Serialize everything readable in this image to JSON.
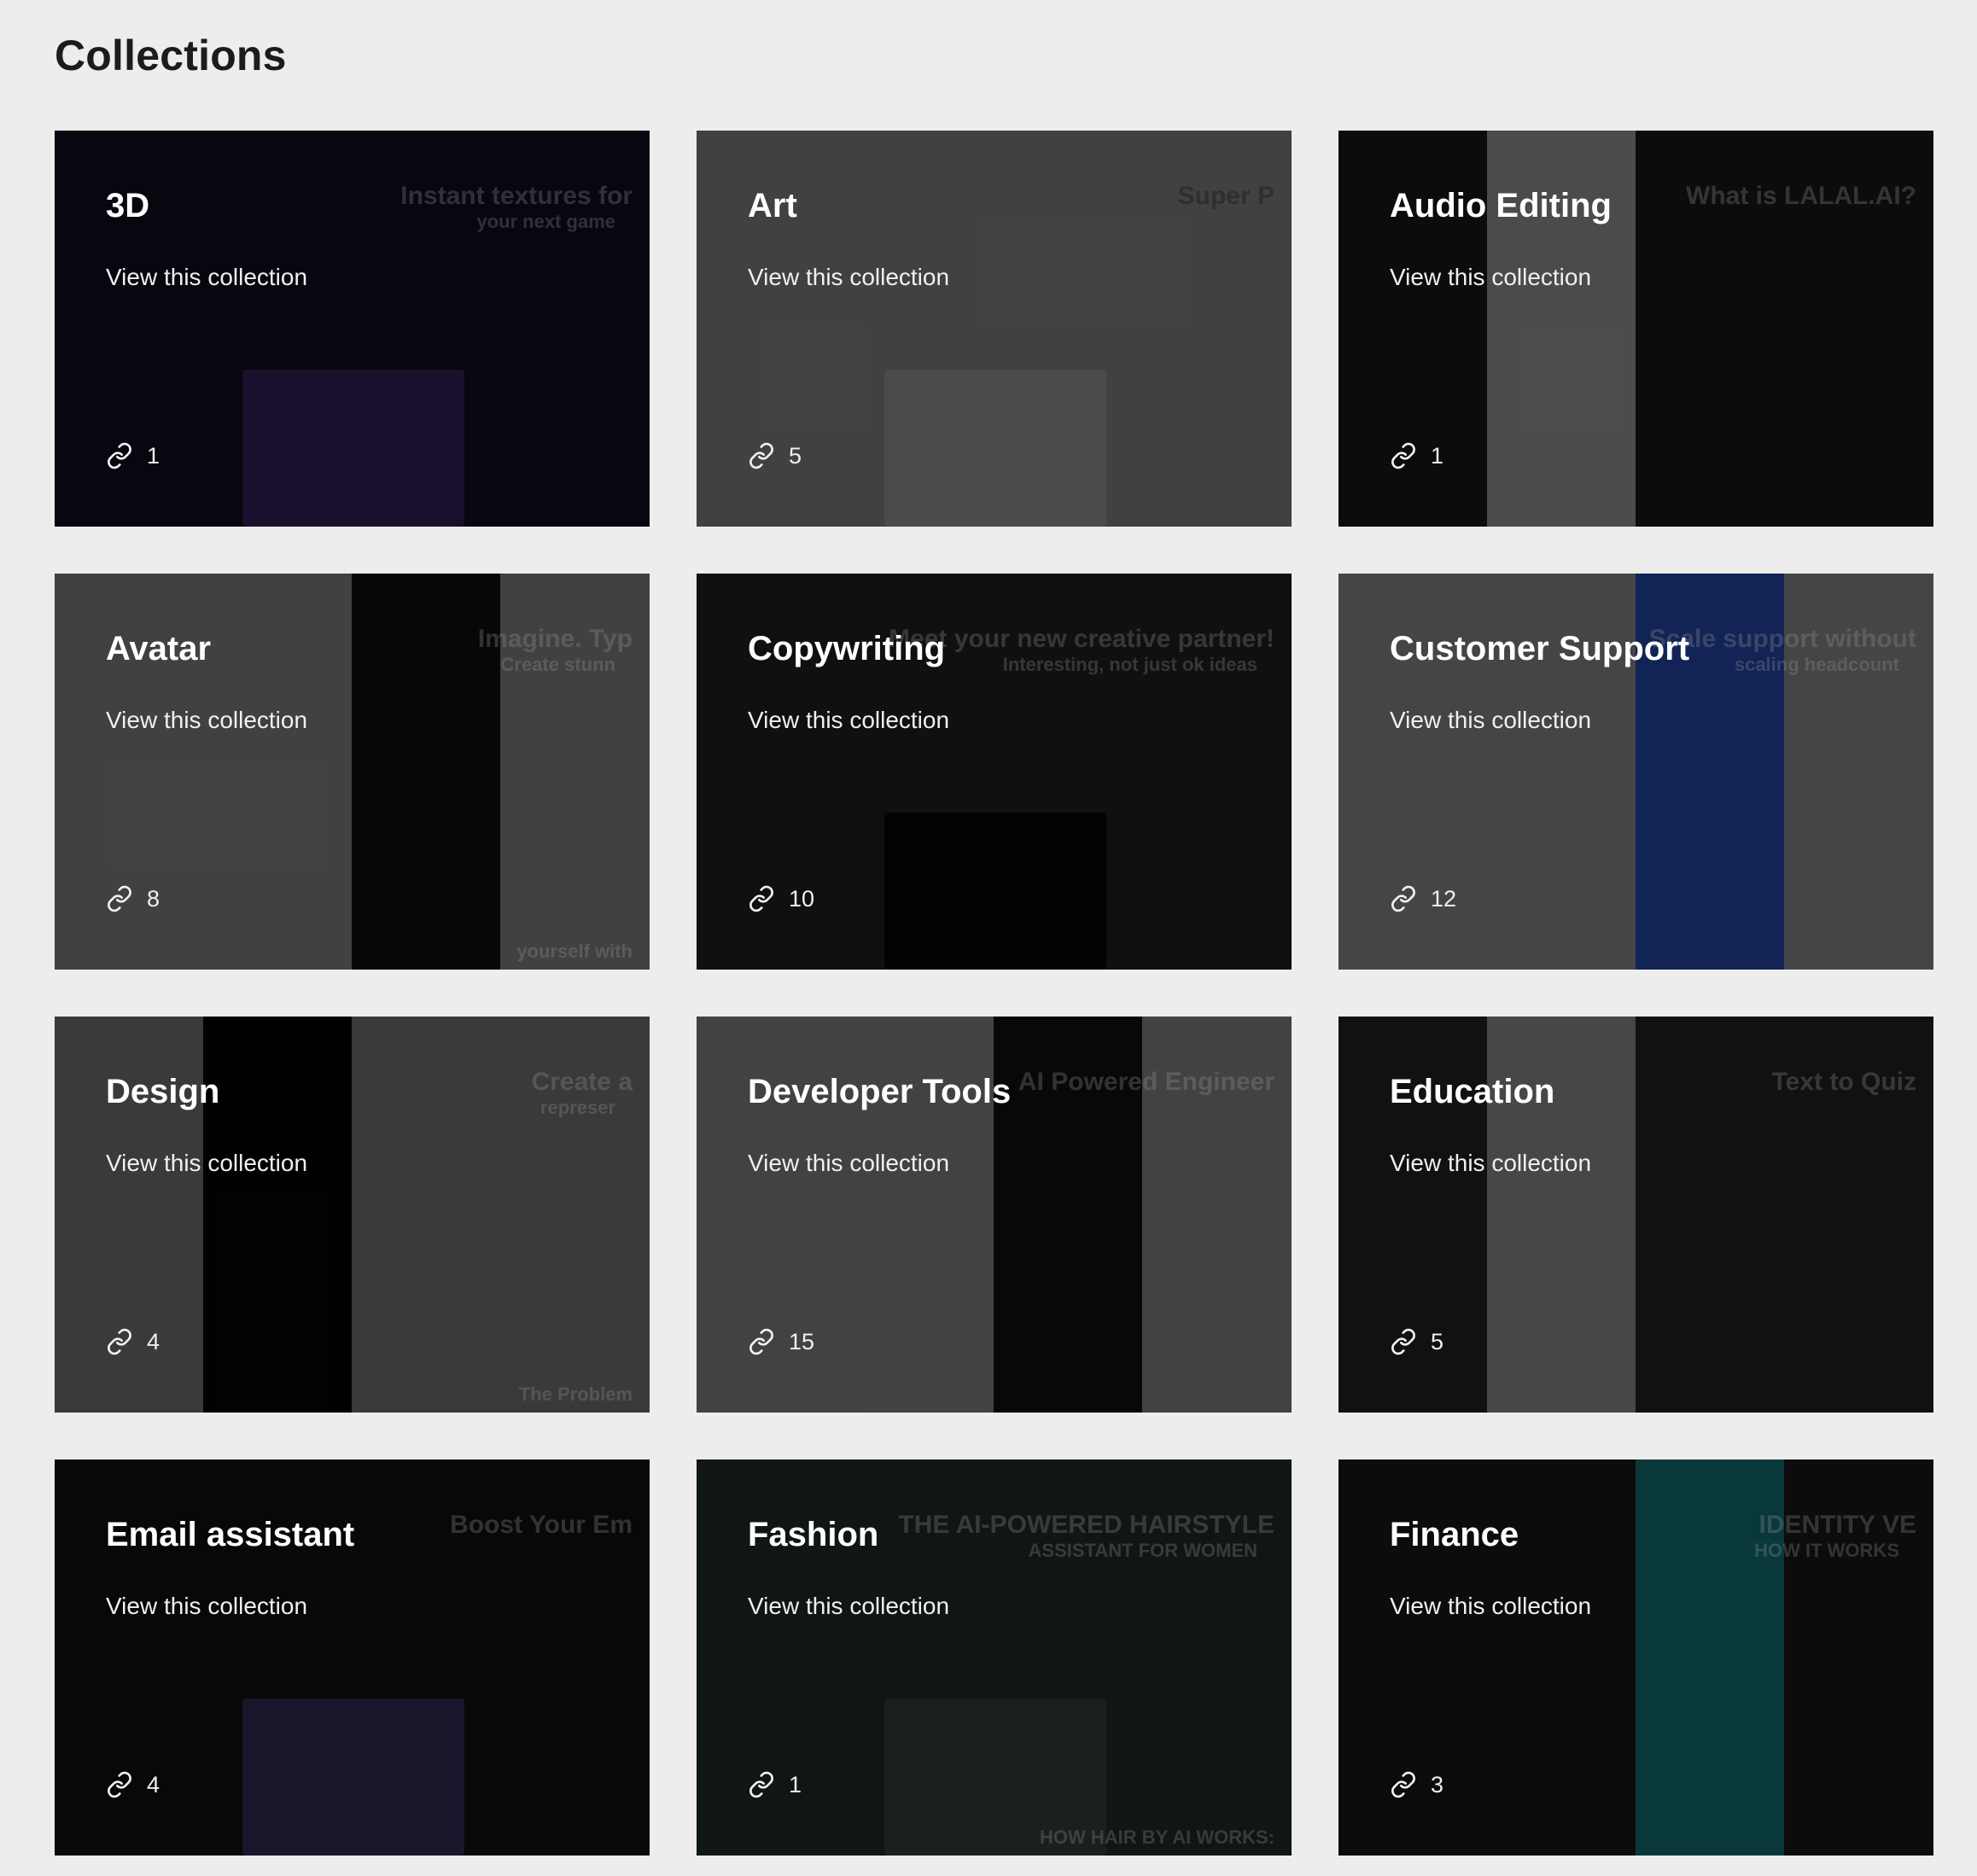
{
  "page": {
    "title": "Collections"
  },
  "collections": [
    {
      "name": "3D",
      "cta": "View this collection",
      "count": "1",
      "bg": "#0d0b18",
      "accent": "#2a1a4a",
      "texts": [
        "Instant textures for",
        "your next game"
      ],
      "theme": "dark"
    },
    {
      "name": "Art",
      "cta": "View this collection",
      "count": "5",
      "bg": "#6a6a6e",
      "accent": "#7a7a7e",
      "texts": [
        "Super P"
      ],
      "theme": "light"
    },
    {
      "name": "Audio Editing",
      "cta": "View this collection",
      "count": "1",
      "bg": "#141414",
      "accent": "#7a7a7a",
      "texts": [
        "What is LALAL.AI?"
      ],
      "theme": "mixed"
    },
    {
      "name": "Avatar",
      "cta": "View this collection",
      "count": "8",
      "bg": "#6a6a6c",
      "accent": "#0c0c0e",
      "texts": [
        "Imagine. Typ",
        "Create stunn",
        "yourself with"
      ],
      "theme": "mixed"
    },
    {
      "name": "Copywriting",
      "cta": "View this collection",
      "count": "10",
      "bg": "#1a1a1c",
      "accent": "#050505",
      "texts": [
        "Meet your new creative partner!",
        "Interesting, not just ok ideas"
      ],
      "theme": "dark"
    },
    {
      "name": "Customer Support",
      "cta": "View this collection",
      "count": "12",
      "bg": "#707074",
      "accent": "#1e3a8a",
      "texts": [
        "Scale support without",
        "scaling headcount"
      ],
      "theme": "mixed"
    },
    {
      "name": "Design",
      "cta": "View this collection",
      "count": "4",
      "bg": "#5e5e60",
      "accent": "#030303",
      "texts": [
        "Create a",
        "represer",
        "The Problem"
      ],
      "theme": "mixed"
    },
    {
      "name": "Developer Tools",
      "cta": "View this collection",
      "count": "15",
      "bg": "#6b6c6a",
      "accent": "#0e0e10",
      "texts": [
        "AI Powered Engineer"
      ],
      "theme": "mixed"
    },
    {
      "name": "Education",
      "cta": "View this collection",
      "count": "5",
      "bg": "#1c1c1e",
      "accent": "#737376",
      "texts": [
        "Text to Quiz"
      ],
      "theme": "mixed"
    },
    {
      "name": "Email assistant",
      "cta": "View this collection",
      "count": "4",
      "bg": "#0e0e10",
      "accent": "#2a2346",
      "texts": [
        "Boost Your Em"
      ],
      "theme": "dark"
    },
    {
      "name": "Fashion",
      "cta": "View this collection",
      "count": "1",
      "bg": "#1b2322",
      "accent": "#2a3433",
      "texts": [
        "THE AI-POWERED HAIRSTYLE",
        "ASSISTANT FOR WOMEN",
        "HOW HAIR BY AI WORKS:"
      ],
      "theme": "dark"
    },
    {
      "name": "Finance",
      "cta": "View this collection",
      "count": "3",
      "bg": "#141416",
      "accent": "#0f5b60",
      "texts": [
        "IDENTITY VE",
        "HOW IT WORKS"
      ],
      "theme": "mixed"
    }
  ]
}
